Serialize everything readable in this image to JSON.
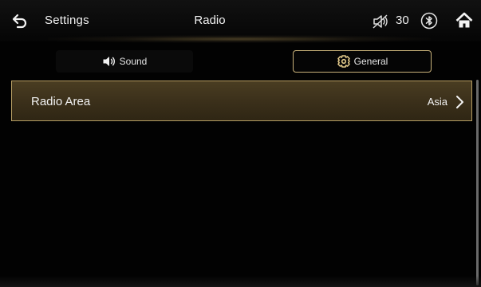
{
  "header": {
    "back_icon": "back-arrow-icon",
    "section_title": "Settings",
    "page_title": "Radio",
    "mute_icon": "speaker-muted-icon",
    "volume_value": "30",
    "bluetooth_icon": "bluetooth-icon",
    "home_icon": "home-icon"
  },
  "tabs": [
    {
      "label": "Sound",
      "icon": "speaker-icon",
      "selected": false
    },
    {
      "label": "General",
      "icon": "gear-icon",
      "selected": true
    }
  ],
  "settings": {
    "items": [
      {
        "label": "Radio Area",
        "value": "Asia",
        "icon": "chevron-right-icon"
      }
    ]
  },
  "colors": {
    "accent": "#c9b27a",
    "row_bg": "#3a2f1a",
    "background": "#020202",
    "text": "#f0f0f0"
  }
}
